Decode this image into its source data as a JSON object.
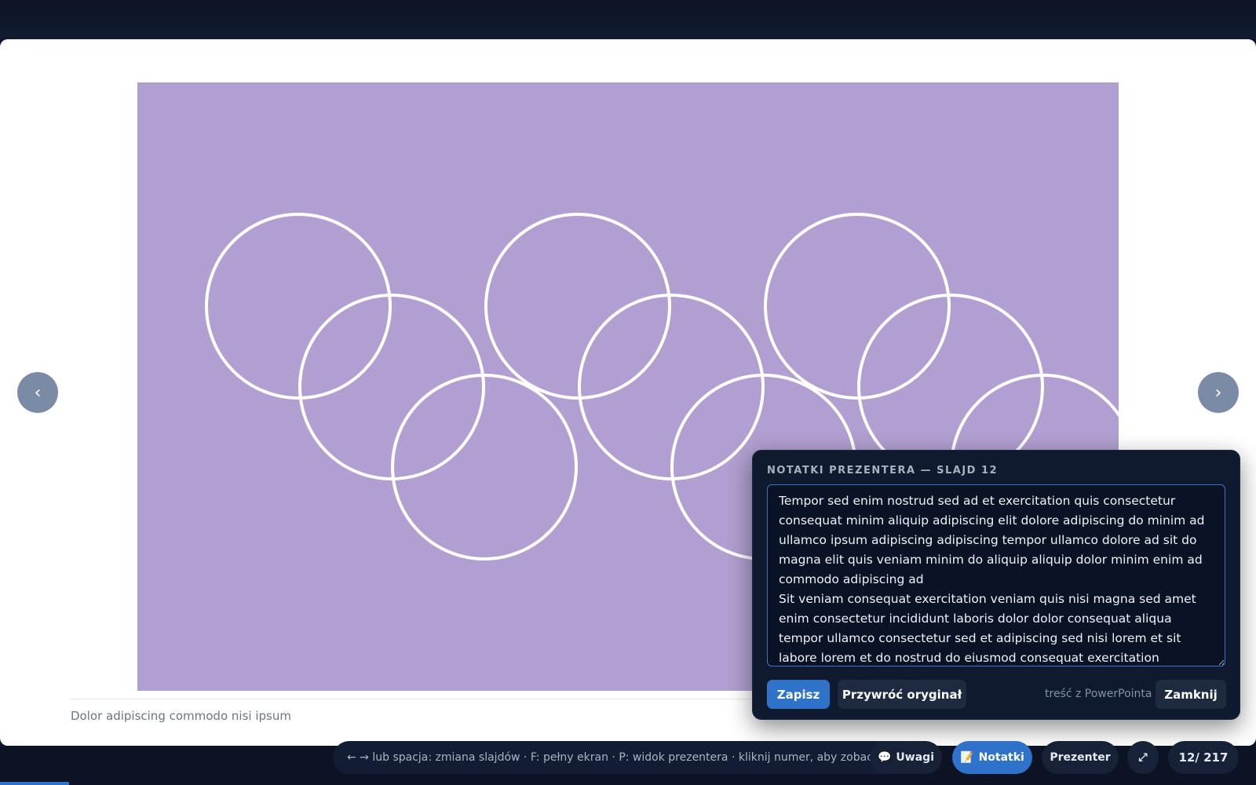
{
  "slide": {
    "background": "#b09fd0",
    "caption": "Dolor adipiscing commodo nisi ipsum"
  },
  "nav": {
    "prev_icon": "‹",
    "next_icon": "›"
  },
  "notes": {
    "title": "NOTATKI PREZENTERA — SLAJD 12",
    "text": "Tempor sed enim nostrud sed ad et exercitation quis consectetur consequat minim aliquip adipiscing elit dolore adipiscing do minim ad ullamco ipsum adipiscing adipiscing tempor ullamco dolore ad sit do magna elit quis veniam minim do aliquip aliquip dolor minim enim ad commodo adipiscing ad\nSit veniam consequat exercitation veniam quis nisi magna sed amet enim consectetur incididunt laboris dolor dolor consequat aliqua tempor ullamco consectetur sed et adipiscing sed nisi lorem et sit labore lorem et do nostrud do eiusmod consequat exercitation",
    "save_label": "Zapisz",
    "restore_label": "Przywróć oryginał",
    "source_label": "treść z PowerPointa",
    "close_label": "Zamknij"
  },
  "toolbar": {
    "hint": "← → lub spacja: zmiana slajdów · F: pełny ekran · P: widok prezentera · kliknij numer, aby zobaczyć wszystkie",
    "comments_icon": "💬",
    "comments_label": "Uwagi",
    "notes_icon": "📝",
    "notes_label": "Notatki",
    "presenter_label": "Prezenter",
    "fullscreen_icon": "⤢",
    "counter": "12/ 217"
  },
  "progress_fraction": 0.055,
  "colors": {
    "accent": "#2e73c9",
    "panel": "#0f1a2e"
  }
}
